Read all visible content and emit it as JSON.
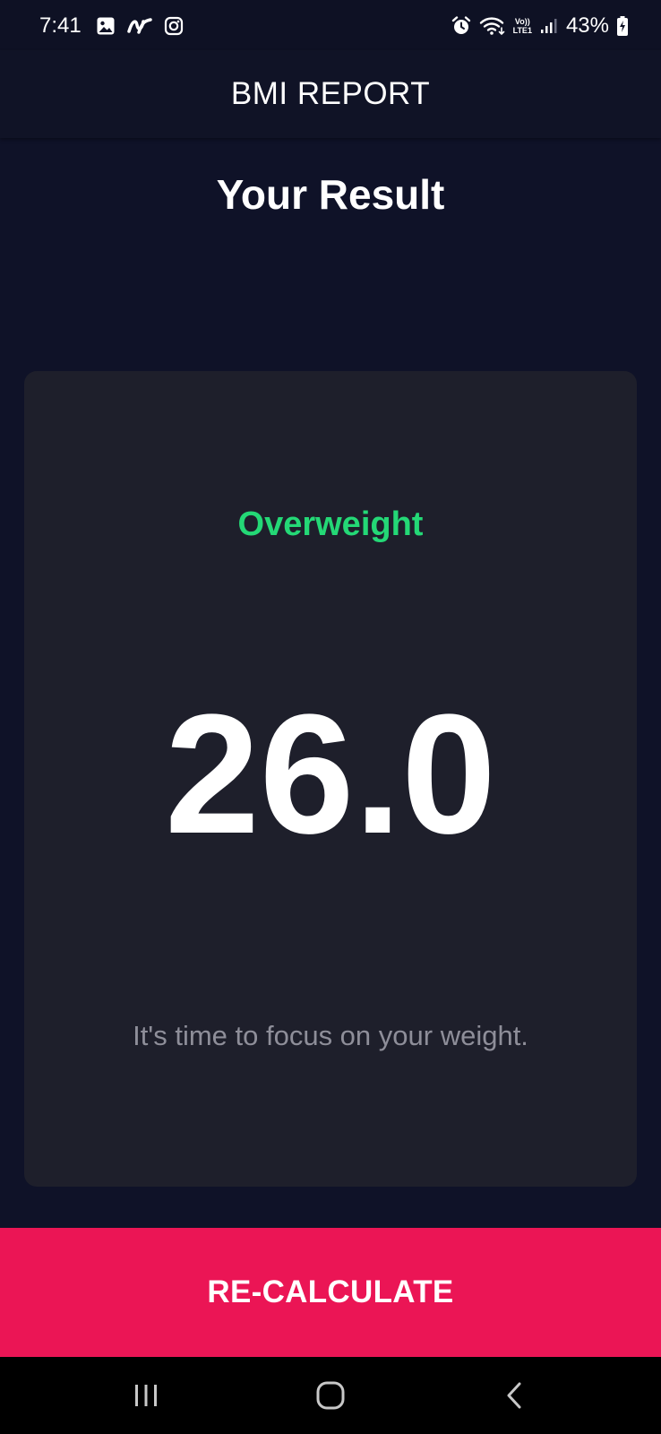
{
  "status_bar": {
    "time": "7:41",
    "battery": "43%",
    "network_label_top": "Vo))",
    "network_label_bottom": "LTE1",
    "icons": [
      "gallery-icon",
      "app-notification-icon",
      "instagram-icon",
      "alarm-icon",
      "wifi-icon",
      "volte-icon",
      "signal-icon",
      "battery-charging-icon"
    ]
  },
  "app_bar": {
    "title": "BMI REPORT"
  },
  "result": {
    "heading": "Your Result",
    "status": "Overweight",
    "bmi_value": "26.0",
    "advice": "It's time to focus on your weight."
  },
  "button": {
    "label": "RE-CALCULATE"
  },
  "nav_bar": {
    "icons": [
      "recents-icon",
      "home-icon",
      "back-icon"
    ]
  },
  "colors": {
    "background": "#0F1228",
    "card": "#1E1F2B",
    "status_green": "#24D876",
    "accent_pink": "#EB1555",
    "muted_text": "#8E8E99"
  }
}
